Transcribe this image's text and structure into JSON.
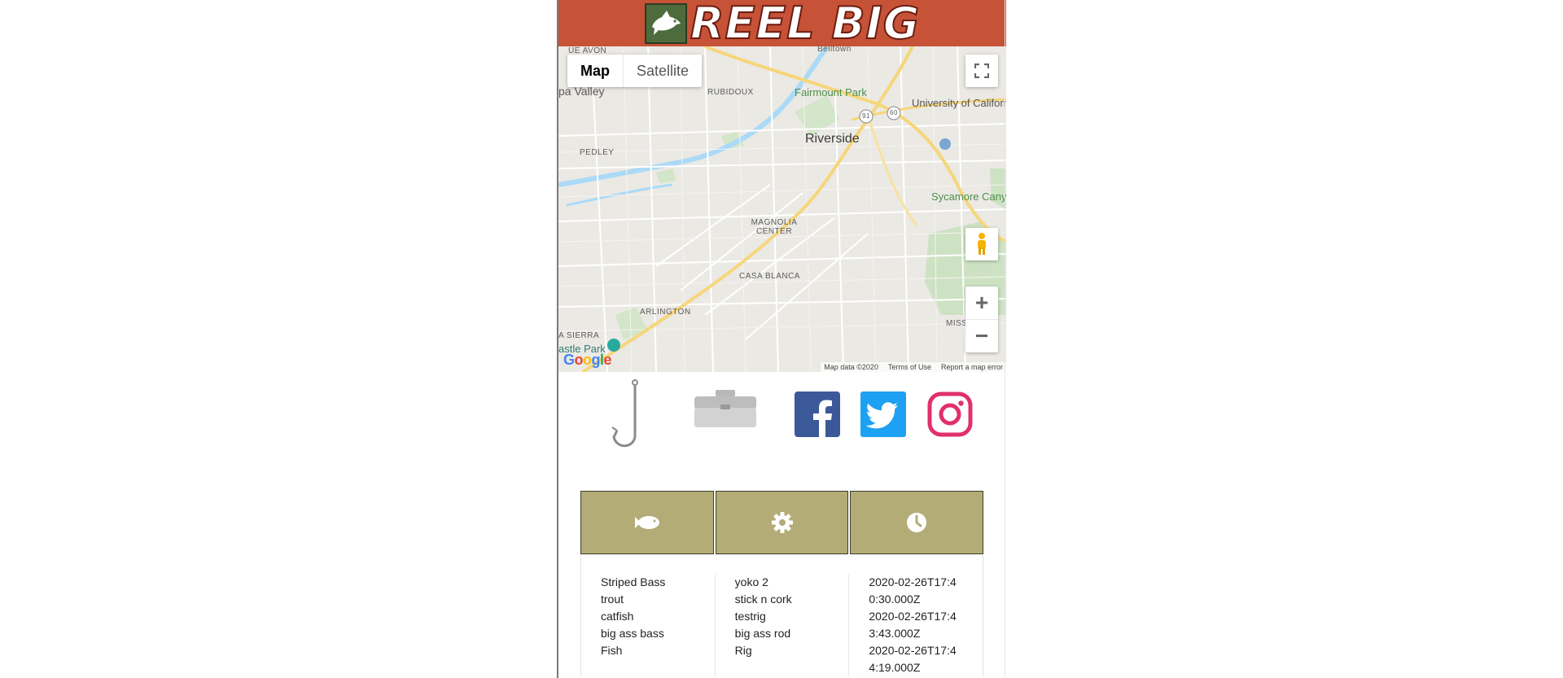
{
  "header": {
    "brand": "REEL BIG",
    "logo_icon": "bass-fish-icon"
  },
  "map": {
    "type_options": [
      "Map",
      "Satellite"
    ],
    "active_type": "Map",
    "labels": {
      "riverside": "Riverside",
      "rubidoux": "RUBIDOUX",
      "pedley": "PEDLEY",
      "magnolia": "MAGNOLIA CENTER",
      "casa_blanca": "CASA BLANCA",
      "arlington": "ARLINGTON",
      "mission_grove": "MISSION G",
      "jurupa_valley": "pa Valley",
      "ue_avon": "UE AVON",
      "belltown": "Belltown",
      "fairmount": "Fairmount Park",
      "ucr": "University of California, Riverside",
      "sycamore": "Sycamore Canyon Wilderness Pa",
      "la_sierra": "A SIERRA",
      "castle_park": "astle Park",
      "route_91": "91",
      "route_60": "60"
    },
    "footer": {
      "map_data": "Map data ©2020",
      "terms": "Terms of Use",
      "report": "Report a map error"
    },
    "google_logo": "Google",
    "controls": {
      "fullscreen_icon": "fullscreen-icon",
      "pegman_icon": "pegman-icon",
      "zoom_in": "+",
      "zoom_out": "−"
    }
  },
  "nav_icons": [
    {
      "name": "hook-icon"
    },
    {
      "name": "tackle-box-icon"
    },
    {
      "name": "facebook-icon",
      "color": "#3b5998"
    },
    {
      "name": "twitter-icon",
      "color": "#1da1f2"
    },
    {
      "name": "instagram-icon",
      "color": "#e1306c"
    }
  ],
  "table": {
    "header_icons": [
      "fish-icon",
      "gear-icon",
      "clock-icon"
    ],
    "header_color": "#b3ac77",
    "fish": [
      "Striped Bass",
      "trout",
      "catfish",
      "big ass bass",
      "Fish"
    ],
    "rigs": [
      "yoko 2",
      "stick n cork",
      "testrig",
      "big ass rod",
      "Rig"
    ],
    "times": [
      "2020-02-26T17:40:30.000Z",
      "2020-02-26T17:43:43.000Z",
      "2020-02-26T17:44:19.000Z"
    ]
  }
}
